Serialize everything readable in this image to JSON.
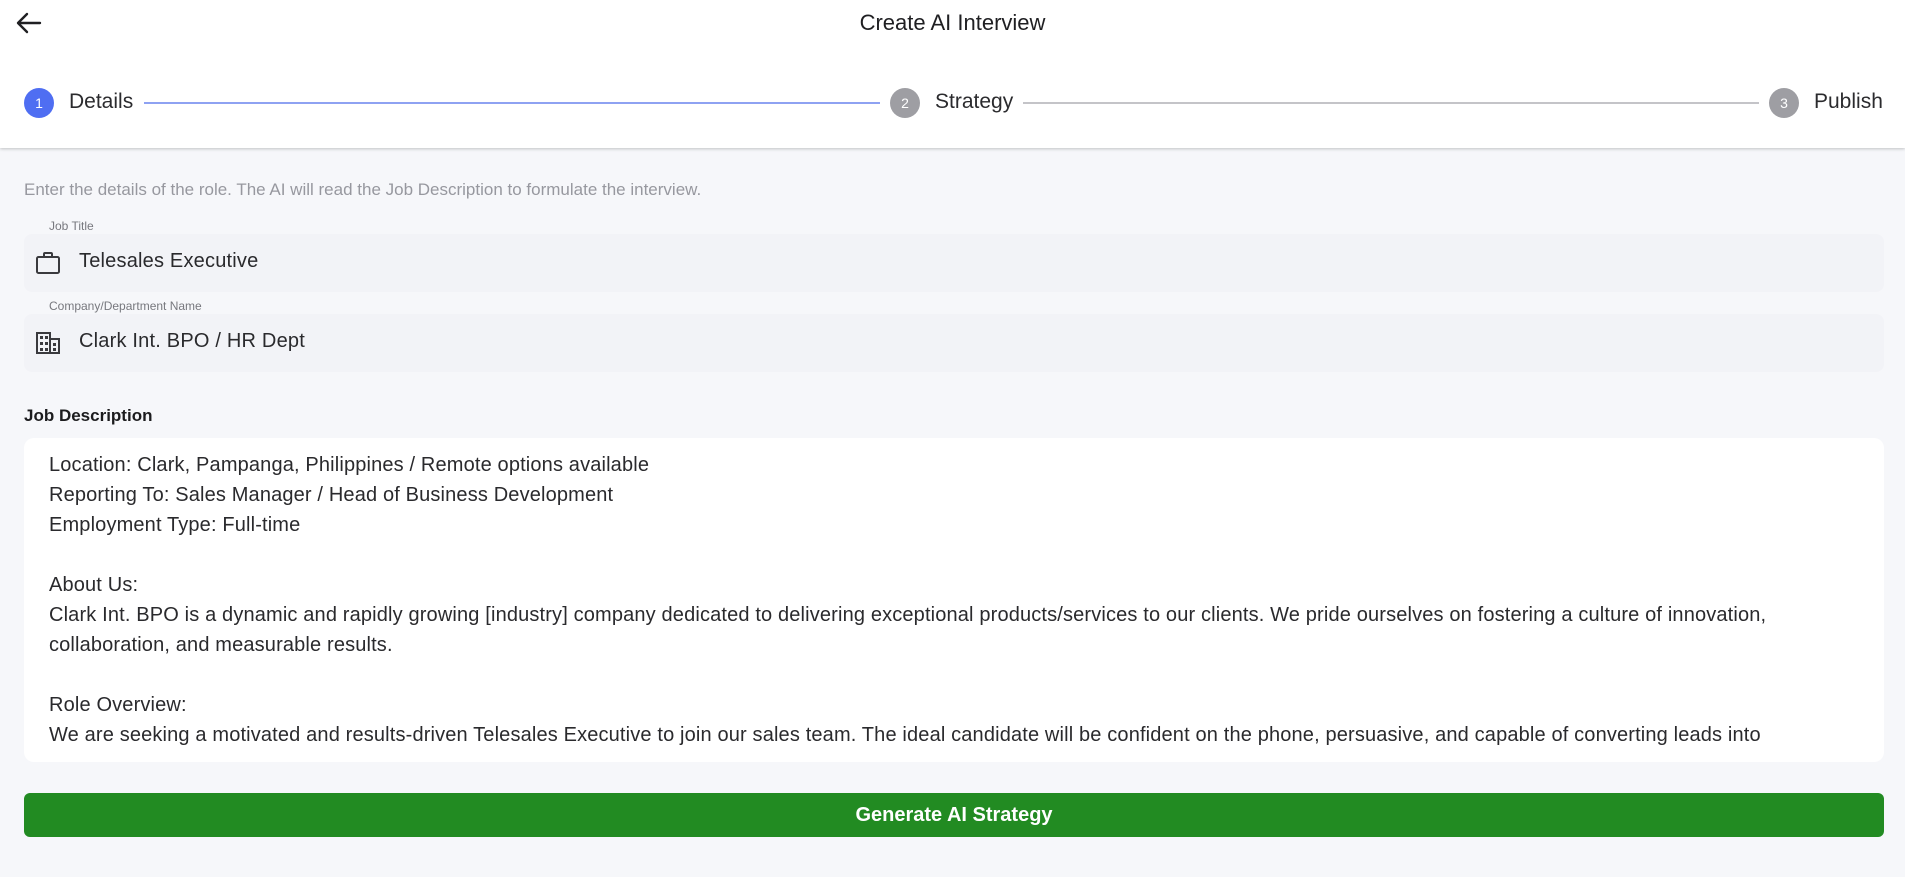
{
  "header": {
    "title": "Create AI Interview",
    "back_icon": "arrow-left-icon"
  },
  "stepper": {
    "steps": [
      {
        "number": "1",
        "label": "Details",
        "active": true
      },
      {
        "number": "2",
        "label": "Strategy",
        "active": false
      },
      {
        "number": "3",
        "label": "Publish",
        "active": false
      }
    ]
  },
  "form": {
    "hint": "Enter the details of the role. The AI will read the Job Description to formulate the interview.",
    "job_title": {
      "label": "Job Title",
      "value": "Telesales Executive",
      "icon": "briefcase-icon"
    },
    "company": {
      "label": "Company/Department Name",
      "value": "Clark Int. BPO / HR Dept",
      "icon": "building-icon"
    },
    "job_description": {
      "label": "Job Description",
      "value": "Location: Clark, Pampanga, Philippines / Remote options available\nReporting To: Sales Manager / Head of Business Development\nEmployment Type: Full-time\n\nAbout Us:\nClark Int. BPO is a dynamic and rapidly growing [industry] company dedicated to delivering exceptional products/services to our clients. We pride ourselves on fostering a culture of innovation, collaboration, and measurable results.\n\nRole Overview:\nWe are seeking a motivated and results-driven Telesales Executive to join our sales team. The ideal candidate will be confident on the phone, persuasive, and capable of converting leads into"
    },
    "generate_label": "Generate AI Strategy"
  },
  "colors": {
    "active_step": "#4f6ef2",
    "inactive_step": "#9e9ea3",
    "active_line": "#8ea2f2",
    "inactive_line": "#c4c4c8",
    "primary_button": "#228b22",
    "background": "#f6f7fa"
  }
}
